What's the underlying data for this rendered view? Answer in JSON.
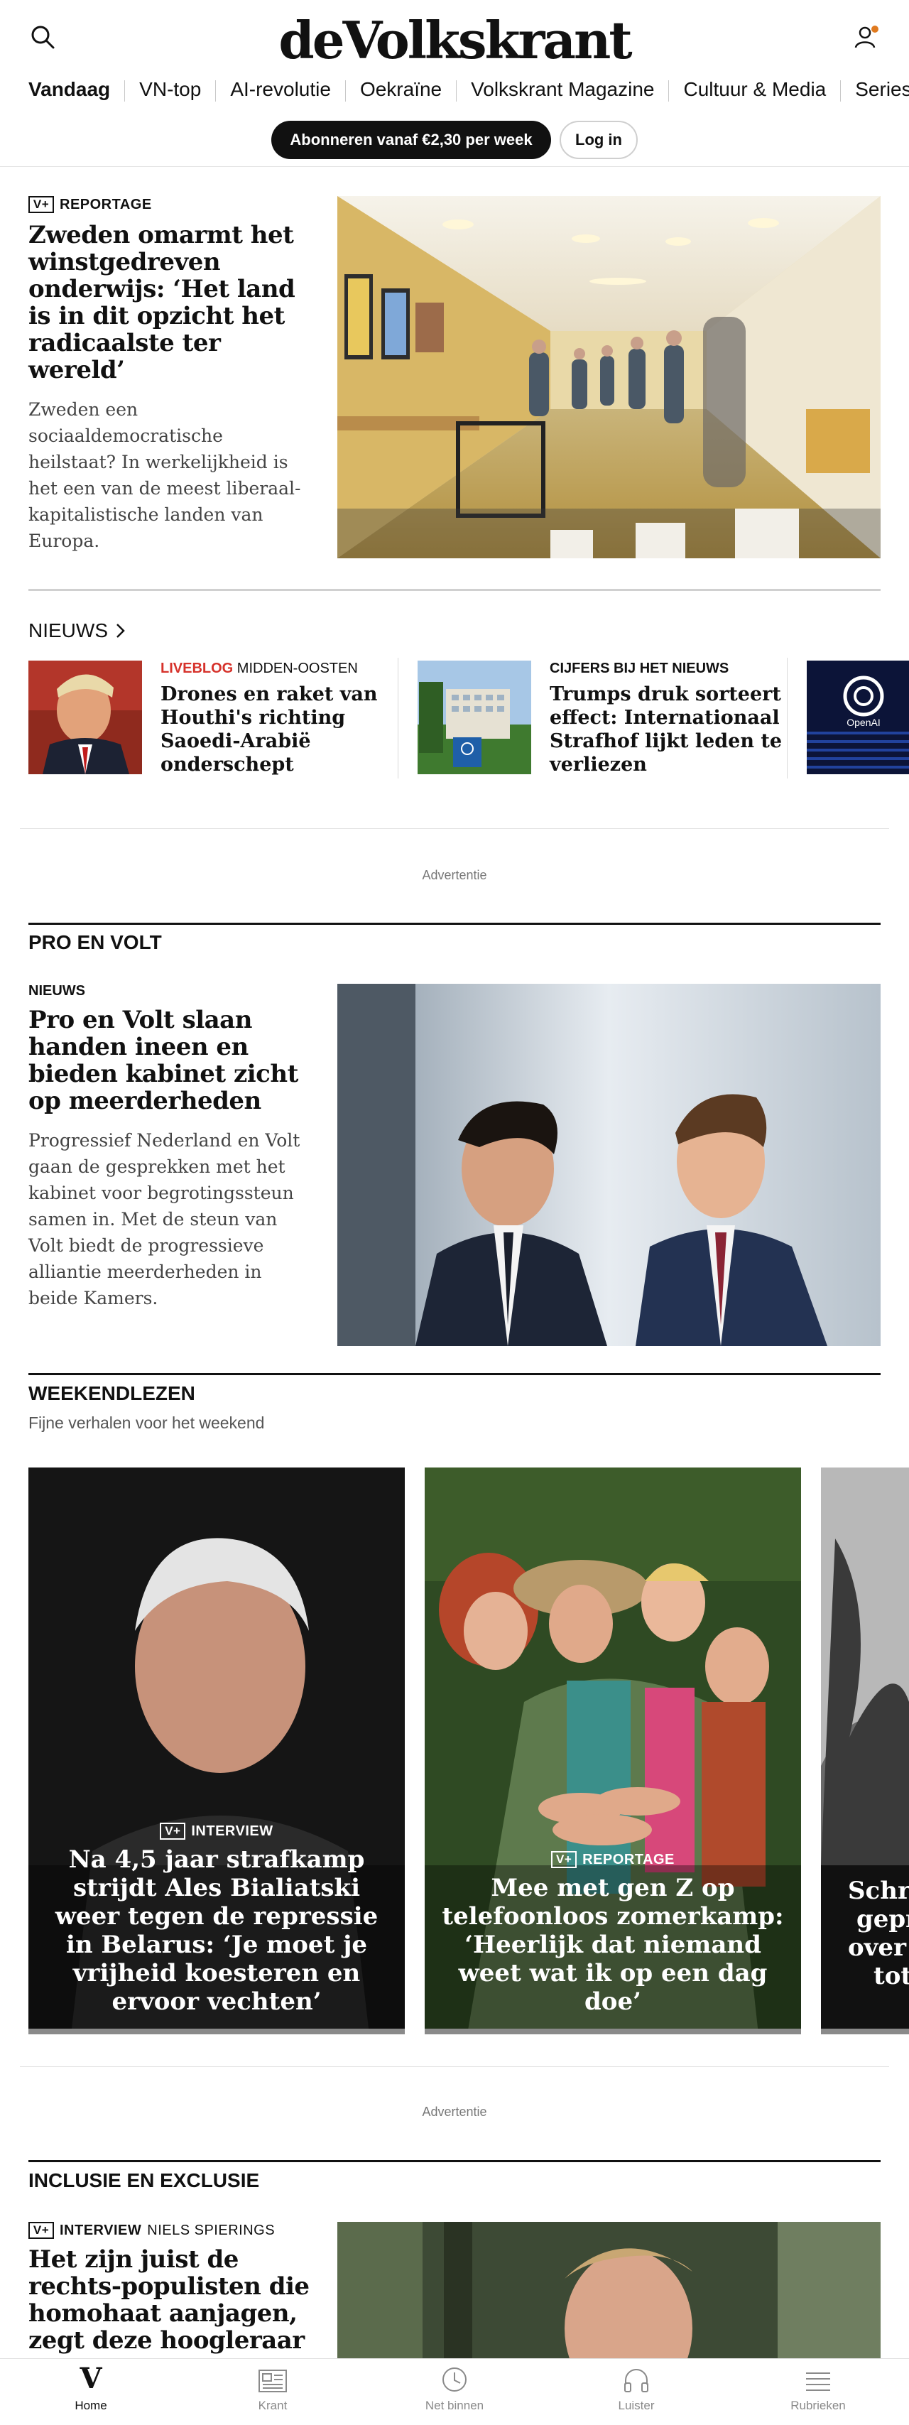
{
  "header": {
    "logo": "deVolkskrant",
    "nav": [
      "Vandaag",
      "VN-top",
      "AI-revolutie",
      "Oekraïne",
      "Volkskrant Magazine",
      "Cultuur & Media",
      "Series"
    ],
    "subscribe_label": "Abonneren vanaf €2,30 per week",
    "login_label": "Log in"
  },
  "lead": {
    "badge": "V+",
    "kicker": "REPORTAGE",
    "title": "Zweden omarmt het winstgedreven onderwijs: ‘Het land is in dit opzicht het radicaalste ter wereld’",
    "lede": "Zweden een sociaaldemocratische heilstaat? In werkelijkheid is het een van de meest liberaal-kapitalistische landen van Europa."
  },
  "news": {
    "heading": "NIEUWS",
    "items": [
      {
        "kicker_red": "LIVEBLOG",
        "kicker": "MIDDEN-OOSTEN",
        "title": "Drones en raket van Houthi's richting Saoedi-Arabië onderschept"
      },
      {
        "kicker_red": "",
        "kicker": "CIJFERS BIJ HET NIEUWS",
        "title": "Trumps druk sorteert effect: Internationaal Strafhof lijkt leden te verliezen"
      }
    ],
    "thumb_text": "OpenAI"
  },
  "ad_label": "Advertentie",
  "pro_en_volt": {
    "section": "PRO EN VOLT",
    "kicker": "NIEUWS",
    "title": "Pro en Volt slaan handen ineen en bieden kabinet zicht op meerderheden",
    "lede": "Progressief Nederland en Volt gaan de gesprekken met het kabinet voor begrotingssteun samen in. Met de steun van Volt biedt de progressieve alliantie meerderheden in beide Kamers."
  },
  "weekend": {
    "section": "WEEKENDLEZEN",
    "subtitle": "Fijne verhalen voor het weekend",
    "cards": [
      {
        "badge": "V+",
        "kicker": "INTERVIEW",
        "title": "Na 4,5 jaar strafkamp strijdt Ales Bialiatski weer tegen de repressie in Belarus: ‘Je moet je vrijheid koesteren en ervoor vechten’"
      },
      {
        "badge": "V+",
        "kicker": "REPORTAGE",
        "title": "Mee met gen Z op telefoonloos zomerkamp: ‘Heerlijk dat niemand weet wat ik op een dag doe’"
      },
      {
        "title_l1": "Schri",
        "title_l2": "gepr",
        "title_l3": "over d",
        "title_l4": "tot"
      }
    ]
  },
  "inclusie": {
    "section": "INCLUSIE EN EXCLUSIE",
    "badge": "V+",
    "kicker": "INTERVIEW",
    "author": "NIELS SPIERINGS",
    "title": "Het zijn juist de rechts-populisten die homohaat aanjagen, zegt deze hoogleraar"
  },
  "tabbar": {
    "items": [
      "Home",
      "Krant",
      "Net binnen",
      "Luister",
      "Rubrieken"
    ]
  },
  "colors": {
    "accent_red": "#d6322b",
    "text": "#111111",
    "muted": "#444444"
  }
}
